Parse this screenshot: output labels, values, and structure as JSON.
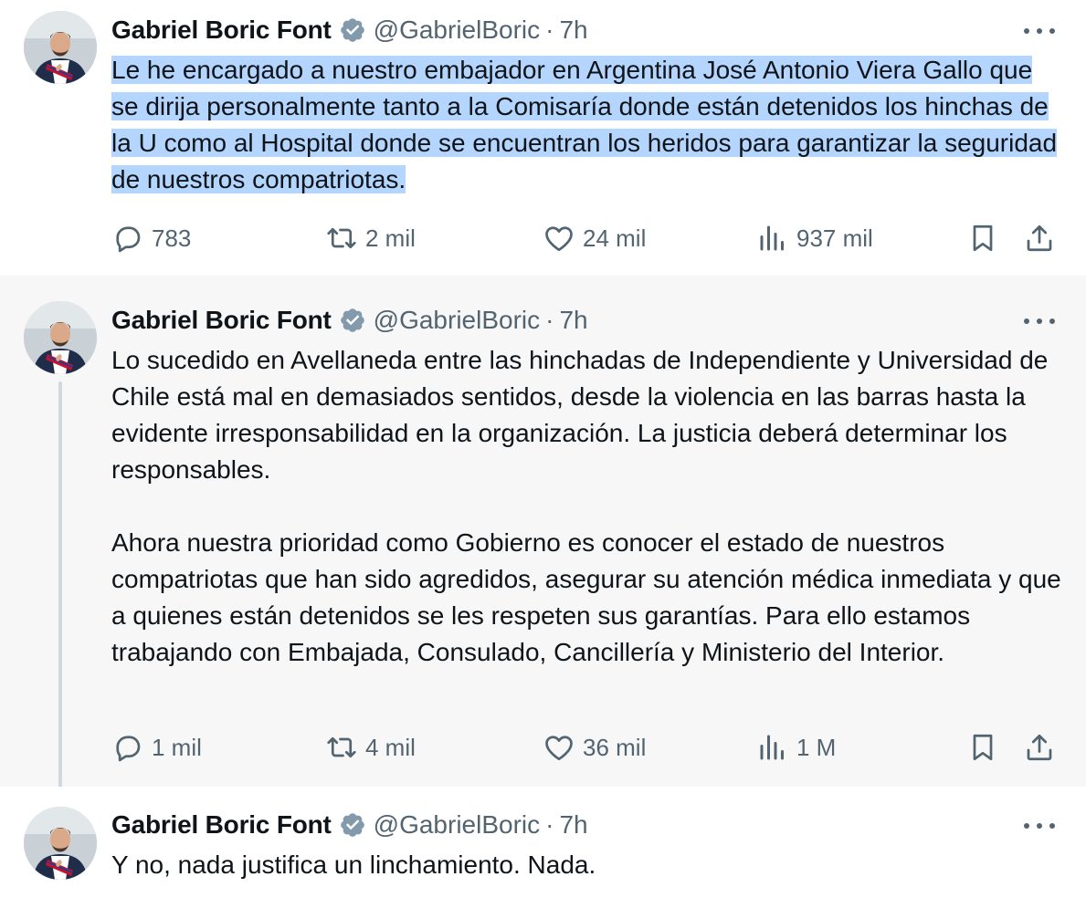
{
  "tweets": [
    {
      "author": {
        "name": "Gabriel Boric Font",
        "handle": "@GabrielBoric",
        "separator": "·",
        "time": "7h"
      },
      "text": "Le he encargado a nuestro embajador en Argentina José Antonio Viera Gallo que se dirija personalmente tanto a la Comisaría donde están detenidos los hinchas de la U como al Hospital donde se encuentran los heridos para garantizar la seguridad de nuestros compatriotas.",
      "text_selected": true,
      "metrics": {
        "replies": "783",
        "reposts": "2 mil",
        "likes": "24 mil",
        "views": "937 mil"
      }
    },
    {
      "author": {
        "name": "Gabriel Boric Font",
        "handle": "@GabrielBoric",
        "separator": "·",
        "time": "7h"
      },
      "paragraphs": [
        "Lo sucedido en Avellaneda entre las hinchadas de Independiente y Universidad de Chile está mal en demasiados sentidos, desde la violencia en las barras hasta la evidente irresponsabilidad en la organización. La justicia deberá determinar los responsables.",
        "Ahora nuestra prioridad como Gobierno es conocer el estado de nuestros compatriotas que han sido agredidos, asegurar su atención médica inmediata y que a quienes están detenidos se les respeten sus garantías. Para ello estamos trabajando con Embajada, Consulado, Cancillería y Ministerio del Interior."
      ],
      "metrics": {
        "replies": "1 mil",
        "reposts": "4 mil",
        "likes": "36 mil",
        "views": "1 M"
      }
    },
    {
      "author": {
        "name": "Gabriel Boric Font",
        "handle": "@GabrielBoric",
        "separator": "·",
        "time": "7h"
      },
      "text": "Y no, nada justifica un linchamiento. Nada."
    }
  ],
  "colors": {
    "text": "#0f1419",
    "secondary": "#536471",
    "selection": "#b4d5fe",
    "verified_badge": "#829aab",
    "highlighted_background": "#f7f7f7",
    "thread_line": "#cfd9de"
  },
  "icons": [
    "verified-badge-icon",
    "more-icon",
    "reply-icon",
    "repost-icon",
    "like-icon",
    "views-icon",
    "bookmark-icon",
    "share-icon"
  ]
}
